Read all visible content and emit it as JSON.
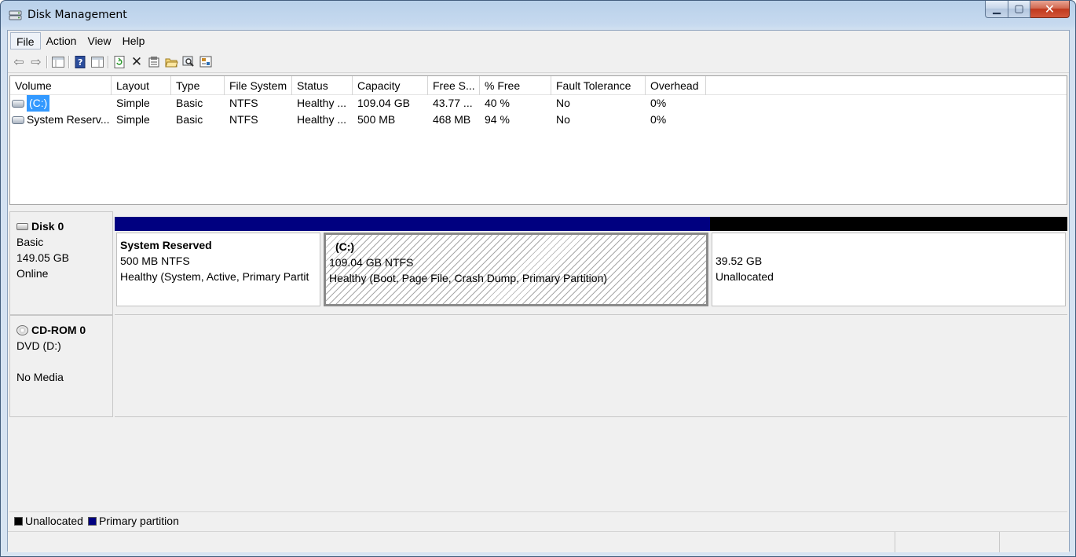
{
  "window": {
    "title": "Disk Management"
  },
  "menu": [
    "File",
    "Action",
    "View",
    "Help"
  ],
  "toolbar": {
    "icons": [
      "back-icon",
      "forward-icon",
      "show-hide-tree-icon",
      "help-icon",
      "properties-view-icon",
      "refresh-icon",
      "delete-icon",
      "properties-icon",
      "open-icon",
      "explore-icon",
      "settings-icon"
    ]
  },
  "volume_table": {
    "columns": [
      "Volume",
      "Layout",
      "Type",
      "File System",
      "Status",
      "Capacity",
      "Free S...",
      "% Free",
      "Fault Tolerance",
      "Overhead"
    ],
    "rows": [
      {
        "volume": "(C:)",
        "layout": "Simple",
        "type": "Basic",
        "fs": "NTFS",
        "status": "Healthy ...",
        "capacity": "109.04 GB",
        "free": "43.77 ...",
        "pct_free": "40 %",
        "fault": "No",
        "overhead": "0%"
      },
      {
        "volume": "System Reserv...",
        "layout": "Simple",
        "type": "Basic",
        "fs": "NTFS",
        "status": "Healthy ...",
        "capacity": "500 MB",
        "free": "468 MB",
        "pct_free": "94 %",
        "fault": "No",
        "overhead": "0%"
      }
    ]
  },
  "disks": [
    {
      "name": "Disk 0",
      "type": "Basic",
      "size": "149.05 GB",
      "state": "Online",
      "partitions": [
        {
          "title": "System Reserved",
          "size": "500 MB NTFS",
          "status": "Healthy (System, Active, Primary Partit",
          "kind": "primary"
        },
        {
          "title": "(C:)",
          "size": "109.04 GB NTFS",
          "status": "Healthy (Boot, Page File, Crash Dump, Primary Partition)",
          "kind": "primary"
        },
        {
          "title": "",
          "size": "39.52 GB",
          "status": "Unallocated",
          "kind": "unallocated"
        }
      ]
    }
  ],
  "cdrom": {
    "name": "CD-ROM 0",
    "drive": "DVD (D:)",
    "media": "No Media"
  },
  "legend": [
    {
      "label": "Unallocated",
      "color": "#000000"
    },
    {
      "label": "Primary partition",
      "color": "#000080"
    }
  ],
  "colors": {
    "primary": "#000080",
    "unallocated": "#000000",
    "selection": "#3399ff"
  }
}
